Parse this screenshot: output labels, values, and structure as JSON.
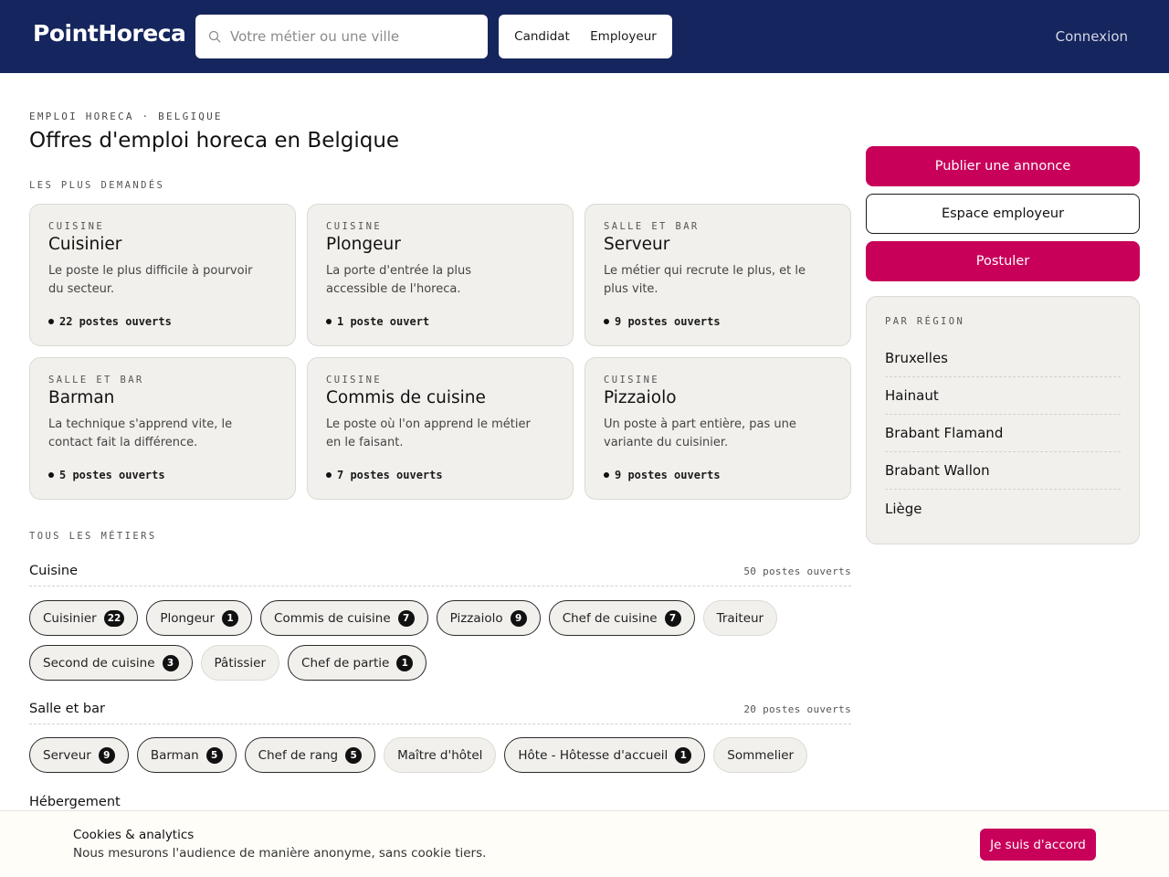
{
  "header": {
    "logo": "PointHoreca",
    "search_placeholder": "Votre métier ou une ville",
    "role_candidate": "Candidat",
    "role_employer": "Employeur",
    "login": "Connexion"
  },
  "main": {
    "eyebrow": "EMPLOI HORECA · BELGIQUE",
    "title": "Offres d'emploi horeca en Belgique",
    "popular_label": "LES PLUS DEMANDÉS",
    "cards": [
      {
        "category": "CUISINE",
        "name": "Cuisinier",
        "description": "Le poste le plus difficile à pourvoir du secteur.",
        "count": "22 postes ouverts"
      },
      {
        "category": "CUISINE",
        "name": "Plongeur",
        "description": "La porte d'entrée la plus accessible de l'horeca.",
        "count": "1 poste ouvert"
      },
      {
        "category": "SALLE ET BAR",
        "name": "Serveur",
        "description": "Le métier qui recrute le plus, et le plus vite.",
        "count": "9 postes ouverts"
      },
      {
        "category": "SALLE ET BAR",
        "name": "Barman",
        "description": "La technique s'apprend vite, le contact fait la différence.",
        "count": "5 postes ouverts"
      },
      {
        "category": "CUISINE",
        "name": "Commis de cuisine",
        "description": "Le poste où l'on apprend le métier en le faisant.",
        "count": "7 postes ouverts"
      },
      {
        "category": "CUISINE",
        "name": "Pizzaiolo",
        "description": "Un poste à part entière, pas une variante du cuisinier.",
        "count": "9 postes ouverts"
      }
    ],
    "all_label": "TOUS LES MÉTIERS",
    "groups": [
      {
        "name": "Cuisine",
        "count": "50 postes ouverts",
        "chips": [
          {
            "label": "Cuisinier",
            "badge": "22"
          },
          {
            "label": "Plongeur",
            "badge": "1"
          },
          {
            "label": "Commis de cuisine",
            "badge": "7"
          },
          {
            "label": "Pizzaiolo",
            "badge": "9"
          },
          {
            "label": "Chef de cuisine",
            "badge": "7"
          },
          {
            "label": "Traiteur",
            "badge": null
          },
          {
            "label": "Second de cuisine",
            "badge": "3"
          },
          {
            "label": "Pâtissier",
            "badge": null
          },
          {
            "label": "Chef de partie",
            "badge": "1"
          }
        ]
      },
      {
        "name": "Salle et bar",
        "count": "20 postes ouverts",
        "chips": [
          {
            "label": "Serveur",
            "badge": "9"
          },
          {
            "label": "Barman",
            "badge": "5"
          },
          {
            "label": "Chef de rang",
            "badge": "5"
          },
          {
            "label": "Maître d'hôtel",
            "badge": null
          },
          {
            "label": "Hôte - Hôtesse d'accueil",
            "badge": "1"
          },
          {
            "label": "Sommelier",
            "badge": null
          }
        ]
      },
      {
        "name": "Hébergement",
        "count": "",
        "chips": []
      }
    ]
  },
  "sidebar": {
    "publish": "Publier une annonce",
    "employer_space": "Espace employeur",
    "apply": "Postuler",
    "region_title": "PAR RÉGION",
    "regions": [
      "Bruxelles",
      "Hainaut",
      "Brabant Flamand",
      "Brabant Wallon",
      "Liège"
    ]
  },
  "cookie": {
    "title": "Cookies & analytics",
    "text": "Nous mesurons l'audience de manière anonyme, sans cookie tiers.",
    "accept": "Je suis d'accord"
  },
  "colors": {
    "header_bg": "#15255d",
    "accent": "#c8005a",
    "card_bg": "#f1f0ec"
  }
}
